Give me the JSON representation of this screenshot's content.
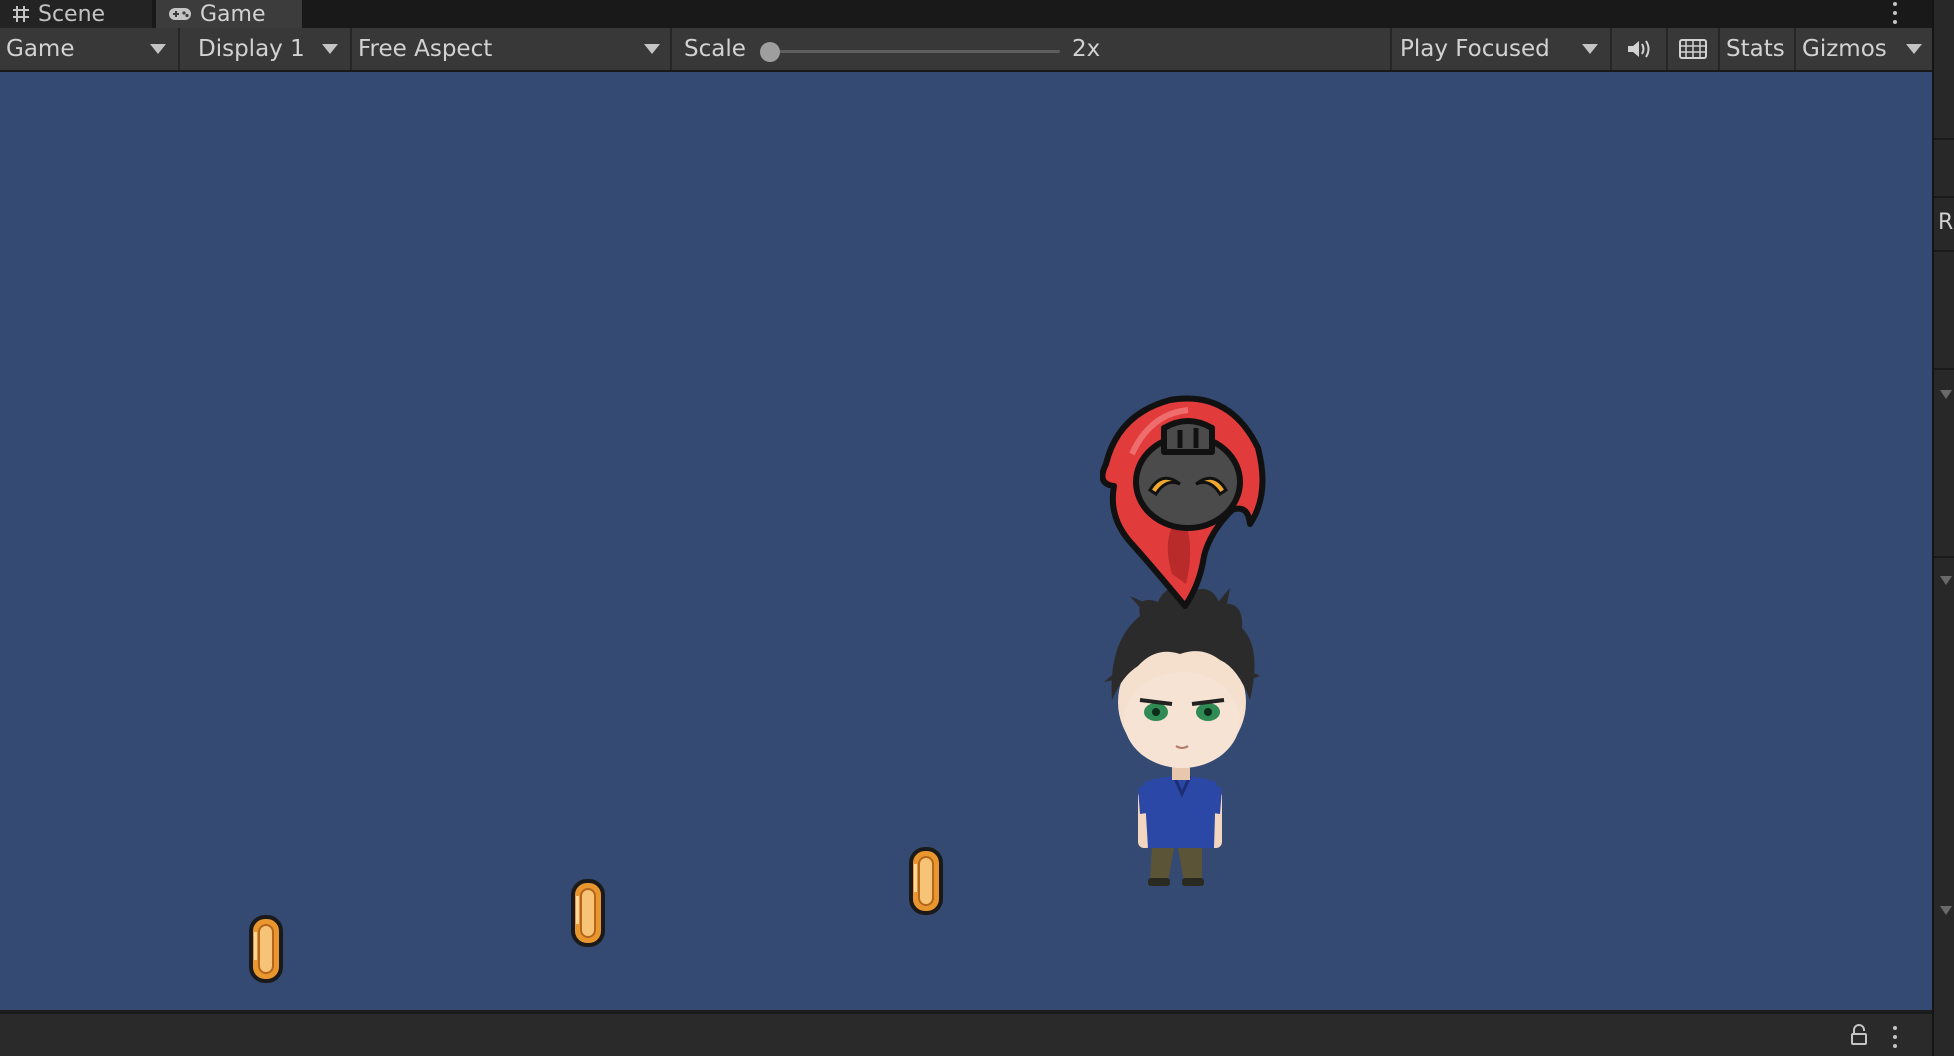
{
  "tabs": [
    {
      "label": "Scene",
      "icon": "grid-icon",
      "active": false
    },
    {
      "label": "Game",
      "icon": "gamepad-icon",
      "active": true
    }
  ],
  "toolbar": {
    "view_mode": "Game",
    "display": "Display 1",
    "aspect": "Free Aspect",
    "scale_label": "Scale",
    "scale_value": "2x",
    "scale_level": 0,
    "play_mode": "Play Focused",
    "audio_icon": "speaker-icon",
    "keyboard_icon": "keyboard-icon",
    "stats": "Stats",
    "gizmos": "Gizmos"
  },
  "right_panel": {
    "letter": "R"
  },
  "colors": {
    "view_background": "#344a72",
    "toolbar": "#383838",
    "tab_active": "#3c3c3c"
  },
  "scene_objects": [
    {
      "name": "coin",
      "count": 3
    },
    {
      "name": "player-character",
      "count": 1
    },
    {
      "name": "fire-pet",
      "count": 1
    }
  ]
}
